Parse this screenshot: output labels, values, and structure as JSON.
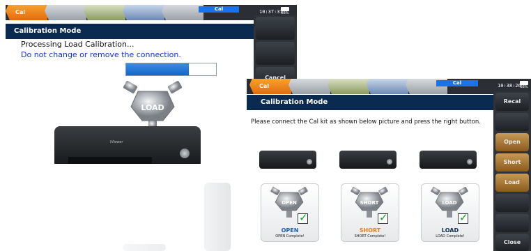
{
  "screen1": {
    "tabs": [
      {
        "label": "Cal",
        "active": true
      },
      {
        "label": ""
      },
      {
        "label": ""
      },
      {
        "label": ""
      },
      {
        "label": ""
      }
    ],
    "mode_badge": "Cal",
    "clock": "10:37:37",
    "battery": "88%",
    "title": "Calibration Mode",
    "message_1": "Processing Load Calibration...",
    "message_2": "Do not change or remove the connection.",
    "progress": 0.7,
    "connector_label": "LOAD",
    "device_logo": "iViewer",
    "softkeys": [
      "",
      "",
      "Cancel"
    ]
  },
  "screen2": {
    "tabs": [
      {
        "label": "Cal",
        "active": true
      },
      {
        "label": ""
      },
      {
        "label": ""
      },
      {
        "label": ""
      },
      {
        "label": ""
      }
    ],
    "mode_badge": "Cal",
    "clock": "10:38:26",
    "battery": "88%",
    "title": "Calibration Mode",
    "instruction": "Please connect the Cal kit as shown below picture and press the right button.",
    "kits": [
      {
        "connector": "OPEN",
        "name": "OPEN",
        "status": "OPEN Complete!",
        "color": "#1a5fb4"
      },
      {
        "connector": "SHORT",
        "name": "SHORT",
        "status": "SHORT Complete!",
        "color": "#e8801a"
      },
      {
        "connector": "LOAD",
        "name": "LOAD",
        "status": "LOAD Complete!",
        "color": "#0b2a50"
      }
    ],
    "softkeys": [
      "Recal",
      "",
      "Open",
      "Short",
      "Load",
      "",
      "",
      "Close"
    ]
  },
  "colors": {
    "accent_orange": "#e36b0c",
    "title_navy": "#0b2a50",
    "progress_blue": "#1566c8",
    "check_green": "#15a02a"
  }
}
